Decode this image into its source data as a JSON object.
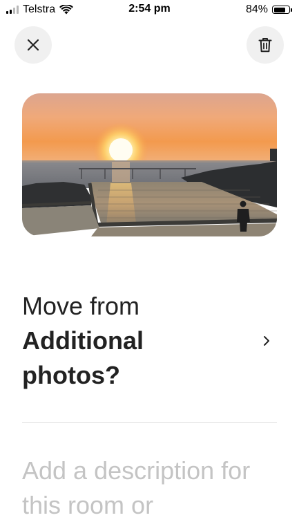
{
  "status_bar": {
    "carrier": "Telstra",
    "time": "2:54 pm",
    "battery_percent": "84%",
    "battery_level": 0.84,
    "signal_bars": 2,
    "signal_bars_total": 4
  },
  "toolbar": {
    "close_icon": "close-icon",
    "delete_icon": "trash-icon"
  },
  "photo": {
    "subject": "sunset over ocean rock pool"
  },
  "move": {
    "line1": "Move from",
    "line2": "Additional",
    "line3": "photos?",
    "chevron_icon": "chevron-right-icon"
  },
  "description": {
    "placeholder": "Add a description for this room or"
  },
  "colors": {
    "text": "#222222",
    "placeholder": "#c4c4c4",
    "button_bg": "#f0f0f0",
    "divider": "#dddddd"
  }
}
